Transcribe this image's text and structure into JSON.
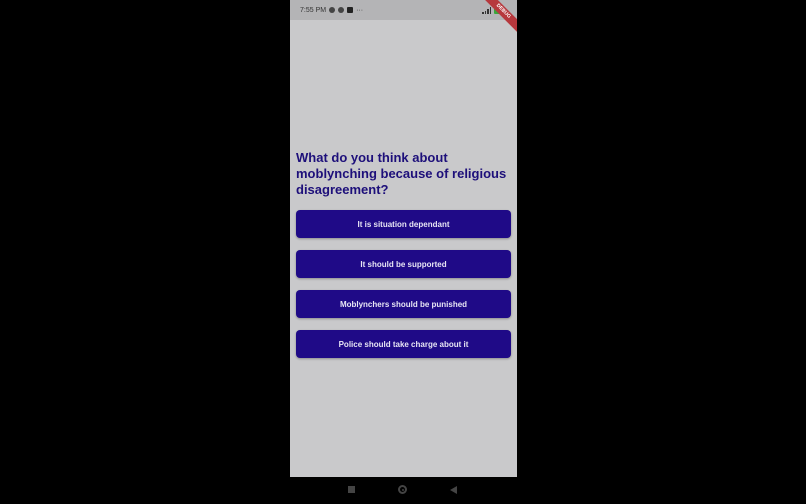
{
  "status_bar": {
    "time": "7:55 PM",
    "more": "···"
  },
  "debug_banner": "DEBUG",
  "question": "What do you think about moblynching because of religious disagreement?",
  "options": [
    {
      "label": "It is situation dependant"
    },
    {
      "label": "It should be supported"
    },
    {
      "label": "Moblynchers should be punished"
    },
    {
      "label": "Police should take charge about it"
    }
  ],
  "colors": {
    "button": "#1f0a87",
    "question_text": "#1d0f7a",
    "background": "#c9c9cb"
  },
  "nav_icons": [
    "recents-square-icon",
    "home-circle-icon",
    "back-triangle-icon"
  ]
}
